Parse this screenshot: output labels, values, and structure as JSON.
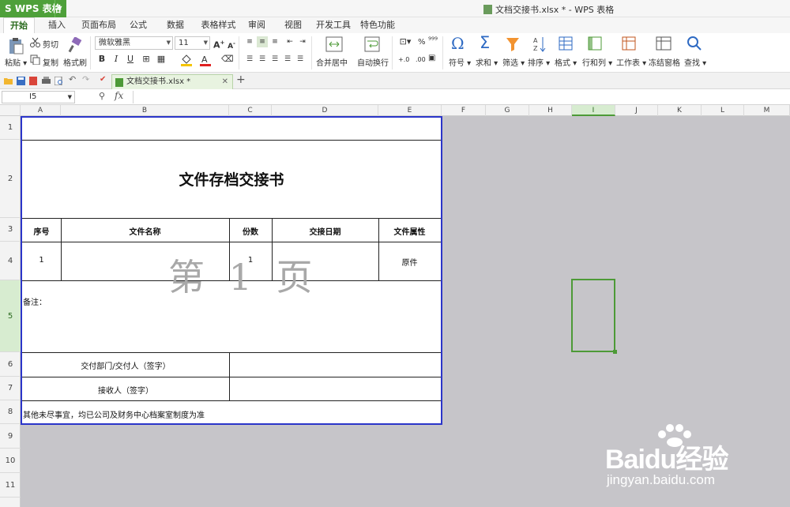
{
  "app": {
    "name": "WPS 表格",
    "window_title": "文档交接书.xlsx * - WPS 表格"
  },
  "menu": {
    "tabs": [
      "开始",
      "插入",
      "页面布局",
      "公式",
      "数据",
      "表格样式",
      "审阅",
      "视图",
      "开发工具",
      "特色功能"
    ],
    "active": "开始"
  },
  "ribbon": {
    "paste": "粘贴",
    "cut": "剪切",
    "copy": "复制",
    "format_painter": "格式刷",
    "font_name": "微软雅黑",
    "font_size": "11",
    "merge_center": "合并居中",
    "wrap_text": "自动换行",
    "symbol": "符号",
    "sum": "求和",
    "filter": "筛选",
    "sort": "排序",
    "format": "格式",
    "row_col": "行和列",
    "sheet": "工作表",
    "freeze": "冻结窗格",
    "find": "查找",
    "percent": "%",
    "num_inc": "+.0",
    "num_dec": ".00"
  },
  "filetab": {
    "name": "文档交接书.xlsx *"
  },
  "formula": {
    "namebox": "I5"
  },
  "columns": [
    "A",
    "B",
    "C",
    "D",
    "E",
    "F",
    "G",
    "H",
    "I",
    "J",
    "K",
    "L",
    "M"
  ],
  "active_column": "I",
  "rows": [
    "1",
    "2",
    "3",
    "4",
    "5",
    "6",
    "7",
    "8",
    "9",
    "10",
    "11"
  ],
  "active_row": "5",
  "sheet": {
    "title": "文件存档交接书",
    "headers": [
      "序号",
      "文件名称",
      "份数",
      "交接日期",
      "文件属性"
    ],
    "row1": {
      "seq": "1",
      "copies": "1",
      "attribute": "原件"
    },
    "remarks": "备注：",
    "deliver": "交付部门/交付人（签字）",
    "receiver": "接收人（签字）",
    "footer": "其他未尽事宜，均已公司及财务中心档案室制度为准",
    "page_watermark": "第 1 页"
  },
  "baidu": {
    "brand": "Baidu经验",
    "url": "jingyan.baidu.com"
  }
}
